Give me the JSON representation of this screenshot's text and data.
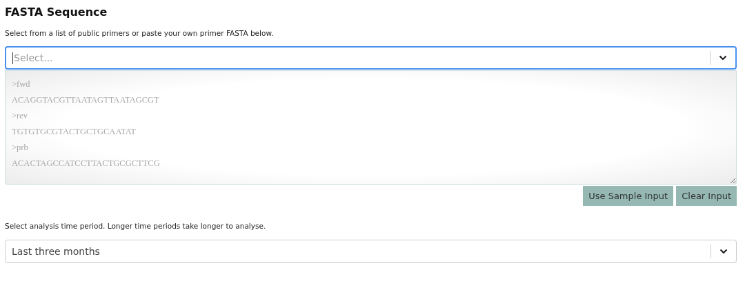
{
  "heading": "FASTA Sequence",
  "primer_hint": "Select from a list of public primers or paste your own primer FASTA below.",
  "primer_select": {
    "placeholder": "Select...",
    "focused": true
  },
  "fasta_input": {
    "placeholder": ">fwd\nACAGGTACGTTAATAGTTAATAGCGT\n>rev\nTGTGTGCGTACTGCTGCAATAT\n>prb\nACACTAGCCATCCTTACTGCGCTTCG"
  },
  "buttons": [
    "Use Sample Input",
    "Clear Input"
  ],
  "period_hint": "Select analysis time period. Longer time periods take longer to analyse.",
  "period_select": {
    "value": "Last three months",
    "focused": false
  }
}
